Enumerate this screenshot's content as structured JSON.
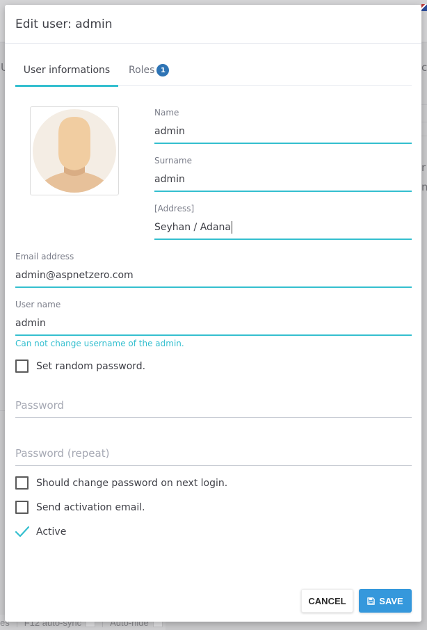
{
  "background": {
    "fragments": [
      "U",
      "c",
      "r",
      "n"
    ],
    "devtools_bar": {
      "items": [
        "es",
        "F12 auto-sync",
        "Auto-hide"
      ]
    }
  },
  "modal": {
    "title": "Edit user: admin",
    "tabs": [
      {
        "label": "User informations",
        "active": true
      },
      {
        "label": "Roles",
        "badge": "1",
        "active": false
      }
    ],
    "avatar": {
      "icon": "user-silhouette-icon"
    },
    "fields": {
      "name": {
        "label": "Name",
        "value": "admin"
      },
      "surname": {
        "label": "Surname",
        "value": "admin"
      },
      "address": {
        "label": "[Address]",
        "value": "Seyhan / Adana"
      },
      "email": {
        "label": "Email address",
        "value": "admin@aspnetzero.com"
      },
      "username": {
        "label": "User name",
        "value": "admin",
        "hint": "Can not change username of the admin."
      },
      "password": {
        "placeholder": "Password",
        "value": ""
      },
      "password_repeat": {
        "placeholder": "Password (repeat)",
        "value": ""
      }
    },
    "checkboxes": {
      "random_password": {
        "label": "Set random password.",
        "checked": false
      },
      "change_password": {
        "label": "Should change password on next login.",
        "checked": false
      },
      "activation_email": {
        "label": "Send activation email.",
        "checked": false
      },
      "active": {
        "label": "Active",
        "checked": true
      }
    },
    "buttons": {
      "cancel": "CANCEL",
      "save": "SAVE",
      "save_icon": "floppy-disk-icon"
    }
  },
  "colors": {
    "accent": "#34bfcf",
    "primary": "#3598dc",
    "badge": "#2e74b5",
    "overlay": "#c9c9cb"
  }
}
